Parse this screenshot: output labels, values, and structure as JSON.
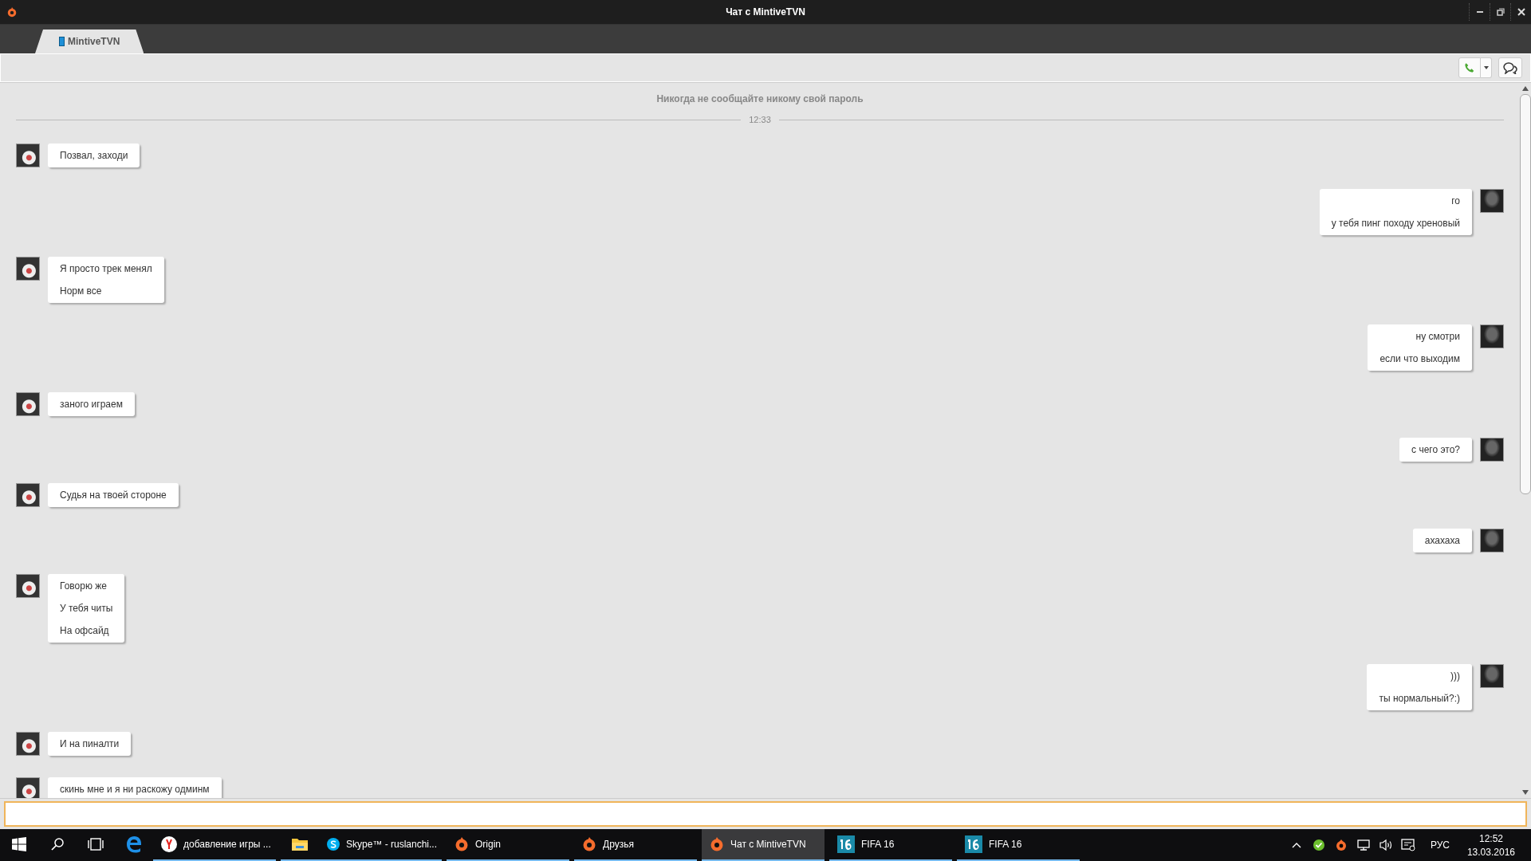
{
  "window": {
    "title": "Чат с MintiveTVN"
  },
  "tabs": [
    {
      "label": "MintiveTVN",
      "selected": true
    }
  ],
  "chat": {
    "notice": "Никогда не сообщайте никому свой пароль",
    "time_divider": "12:33",
    "messages": [
      {
        "kind": "received",
        "lines": [
          "Позвал, заходи"
        ]
      },
      {
        "kind": "sent",
        "lines": [
          "го",
          "у тебя пинг походу хреновый"
        ]
      },
      {
        "kind": "received",
        "lines": [
          "Я просто трек менял",
          "Норм все"
        ]
      },
      {
        "kind": "sent",
        "lines": [
          "ну смотри",
          "если что выходим"
        ]
      },
      {
        "kind": "received",
        "lines": [
          "заного играем"
        ]
      },
      {
        "kind": "sent",
        "lines": [
          "с чего это?"
        ]
      },
      {
        "kind": "received",
        "lines": [
          "Судья на твоей стороне"
        ]
      },
      {
        "kind": "sent",
        "lines": [
          "ахахаха"
        ]
      },
      {
        "kind": "received",
        "lines": [
          "Говорю же",
          "У тебя читы",
          "На офсайд"
        ]
      },
      {
        "kind": "sent",
        "lines": [
          ")))",
          "ты нормальный?:)"
        ]
      },
      {
        "kind": "received",
        "lines": [
          "И на пиналти"
        ]
      },
      {
        "kind": "received",
        "lines": [
          "скинь мне и я ни раскожу одминм"
        ]
      }
    ]
  },
  "taskbar": {
    "items": [
      {
        "kind": "edge",
        "running": false,
        "selected": false
      },
      {
        "kind": "yandex",
        "label": "добавление игры ...",
        "running": true,
        "selected": false
      },
      {
        "kind": "explorer",
        "running": true,
        "selected": false
      },
      {
        "kind": "skype",
        "label": "Skype™ - ruslanchi...",
        "running": true,
        "selected": false
      },
      {
        "kind": "origin",
        "label": "Origin",
        "running": true,
        "selected": false
      },
      {
        "kind": "origin",
        "label": "Друзья",
        "running": true,
        "selected": false
      },
      {
        "kind": "origin",
        "label": "Чат с MintiveTVN",
        "running": true,
        "selected": true
      },
      {
        "kind": "fifa",
        "label": "FIFA 16",
        "running": true,
        "selected": false
      },
      {
        "kind": "fifa",
        "label": "FIFA 16",
        "running": true,
        "selected": false
      }
    ],
    "language": "РУС",
    "time": "12:52",
    "date": "13.03.2016"
  }
}
